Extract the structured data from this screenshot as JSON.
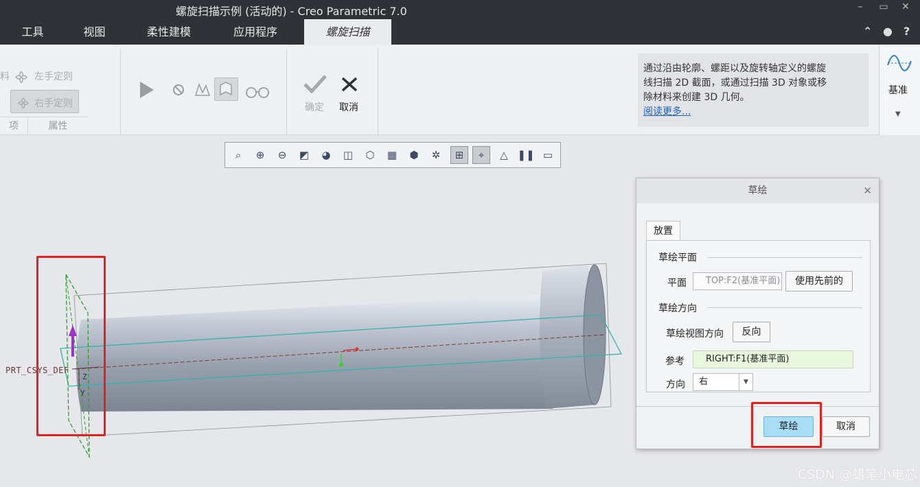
{
  "window": {
    "title": "螺旋扫描示例 (活动的) - Creo Parametric 7.0",
    "controls": {
      "minimize": "–",
      "restore": "▭",
      "close": "✕"
    }
  },
  "ribbon_tabs": [
    {
      "label": "工具"
    },
    {
      "label": "视图"
    },
    {
      "label": "柔性建模"
    },
    {
      "label": "应用程序"
    },
    {
      "label": "螺旋扫描",
      "active": true
    }
  ],
  "ribbon": {
    "left_hand": "左手定则",
    "right_hand": "右手定则",
    "partial_left": "料",
    "foot_partial": "项",
    "foot_properties": "属性",
    "ok_label": "确定",
    "cancel_label": "取消",
    "help_text_1": "通过沿由轮廓、螺距以及旋转轴定义的螺旋",
    "help_text_2": "线扫描 2D 截面，或通过扫描 3D 对象或移",
    "help_text_3": "除材料来创建 3D 几何。",
    "help_link": "阅读更多...",
    "datum_label": "基准"
  },
  "gfx_toolbar_icons": [
    "refit-icon",
    "zoom-in-icon",
    "zoom-out-icon",
    "repaint-icon",
    "display-style-icon",
    "saved-orientation-icon",
    "view-manager-icon",
    "section-view-icon",
    "perspective-icon",
    "datum-display-icon",
    "annotation-display-icon",
    "spin-center-icon",
    "appearance-icon",
    "pause-icon",
    "named-view-icon"
  ],
  "viewport": {
    "csys_label": "PRT_CSYS_DEF",
    "axis_z": "Z",
    "axis_y": "Y"
  },
  "dialog": {
    "title": "草绘",
    "tab_placement": "放置",
    "section_plane": "草绘平面",
    "plane_label": "平面",
    "plane_value": "TOP:F2(基准平面)",
    "use_previous": "使用先前的",
    "section_orientation": "草绘方向",
    "view_direction_label": "草绘视图方向",
    "flip_button": "反向",
    "reference_label": "参考",
    "reference_value": "RIGHT:F1(基准平面)",
    "orientation_label": "方向",
    "orientation_value": "右",
    "sketch_button": "草绘",
    "cancel_button": "取消"
  },
  "watermark": "CSDN @蜡笔小电芯"
}
